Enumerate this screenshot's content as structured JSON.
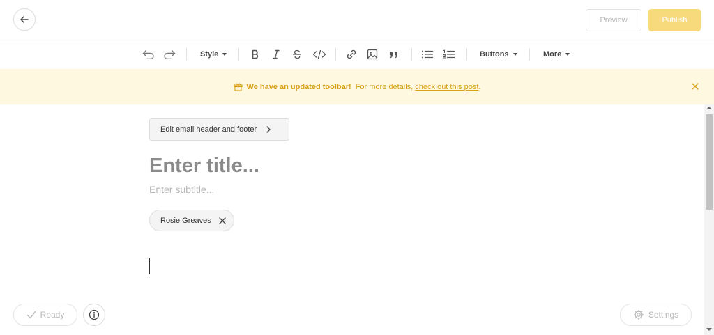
{
  "header": {
    "preview_label": "Preview",
    "publish_label": "Publish",
    "accent_color": "#f7da7b"
  },
  "toolbar": {
    "style_label": "Style",
    "buttons_label": "Buttons",
    "more_label": "More"
  },
  "notice": {
    "bold_text": "We have an updated toolbar!",
    "text": "For more details,",
    "link_text": "check out this post",
    "period": ".",
    "color": "#d6a017"
  },
  "editor": {
    "edit_header_footer_label": "Edit email header and footer",
    "title_placeholder": "Enter title...",
    "subtitle_placeholder": "Enter subtitle...",
    "author_name": "Rosie Greaves"
  },
  "footer": {
    "status_label": "Ready",
    "settings_label": "Settings"
  },
  "icons": [
    "back-arrow-icon",
    "undo-icon",
    "redo-icon",
    "bold-icon",
    "italic-icon",
    "strikethrough-icon",
    "code-icon",
    "link-icon",
    "image-icon",
    "quote-icon",
    "bullet-list-icon",
    "numbered-list-icon",
    "gift-icon",
    "close-icon",
    "chevron-right-icon",
    "check-icon",
    "info-icon",
    "gear-icon"
  ]
}
